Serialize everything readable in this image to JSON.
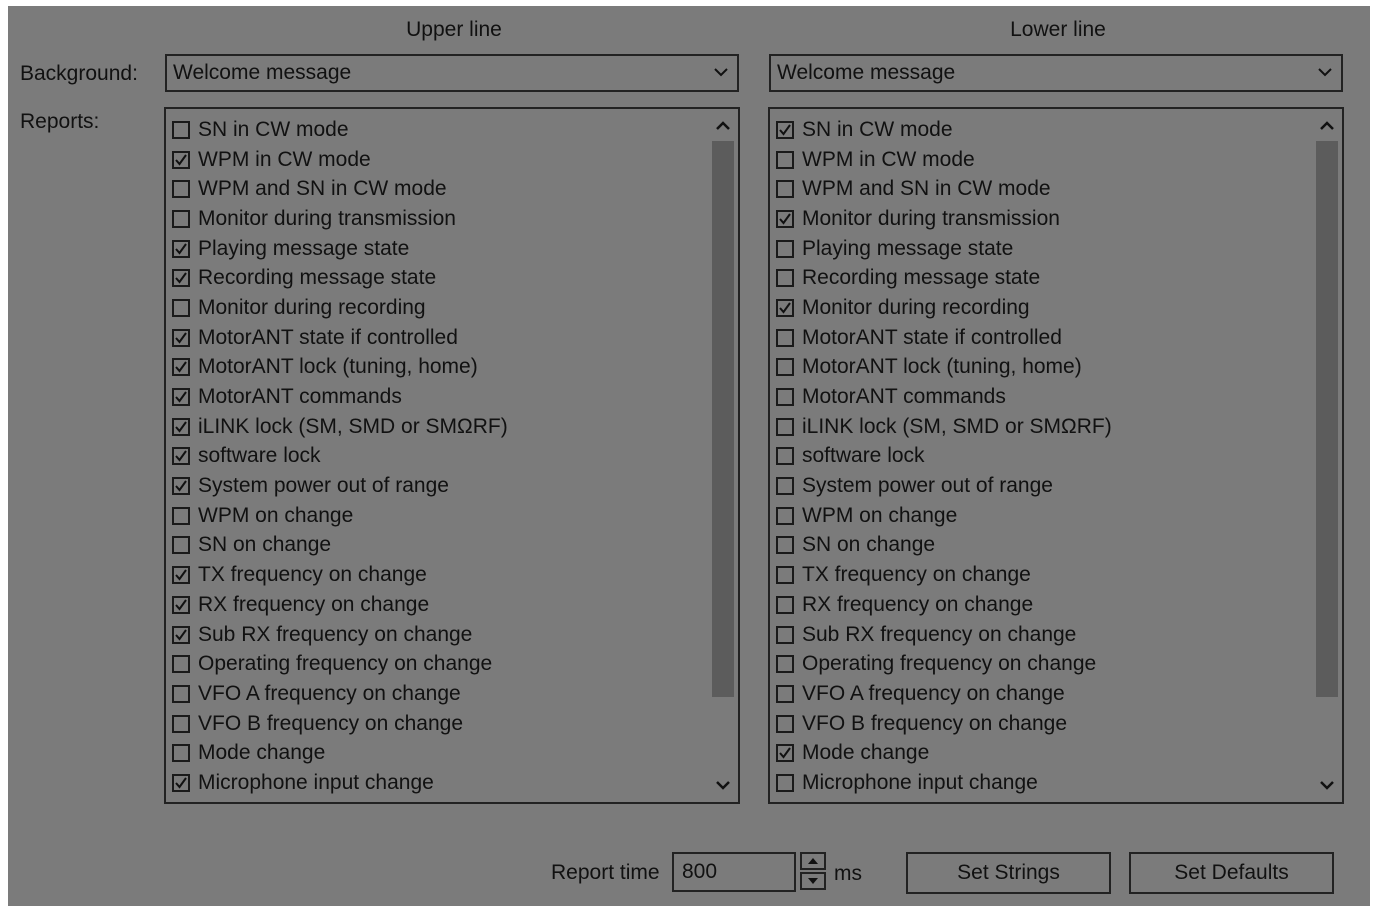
{
  "columns": {
    "upper_title": "Upper line",
    "lower_title": "Lower line"
  },
  "labels": {
    "background": "Background:",
    "reports": "Reports:"
  },
  "background_select": {
    "upper_value": "Welcome message",
    "lower_value": "Welcome message"
  },
  "reports": {
    "items": [
      "SN in CW mode",
      "WPM in CW mode",
      "WPM and SN in CW mode",
      "Monitor during transmission",
      "Playing message state",
      "Recording message state",
      "Monitor during recording",
      "MotorANT state if controlled",
      "MotorANT lock (tuning, home)",
      "MotorANT commands",
      "iLINK lock (SM, SMD or SMΩRF)",
      "software lock",
      "System power out of range",
      "WPM on change",
      "SN on change",
      "TX frequency on change",
      "RX frequency on change",
      "Sub RX frequency on change",
      "Operating frequency on change",
      "VFO A frequency on change",
      "VFO B frequency on change",
      "Mode change",
      "Microphone input change"
    ],
    "upper_checked": [
      false,
      true,
      false,
      false,
      true,
      true,
      false,
      true,
      true,
      true,
      true,
      true,
      true,
      false,
      false,
      true,
      true,
      true,
      false,
      false,
      false,
      false,
      true
    ],
    "lower_checked": [
      true,
      false,
      false,
      true,
      false,
      false,
      true,
      false,
      false,
      false,
      false,
      false,
      false,
      false,
      false,
      false,
      false,
      false,
      false,
      false,
      false,
      true,
      false
    ]
  },
  "footer": {
    "report_time_label": "Report time",
    "report_time_value": "800",
    "unit": "ms",
    "set_strings_label": "Set Strings",
    "set_defaults_label": "Set Defaults"
  },
  "icons": {
    "dropdown": "chevron-down-icon",
    "scroll_up": "chevron-up-icon",
    "scroll_down": "chevron-down-icon",
    "check": "checkmark-icon"
  }
}
